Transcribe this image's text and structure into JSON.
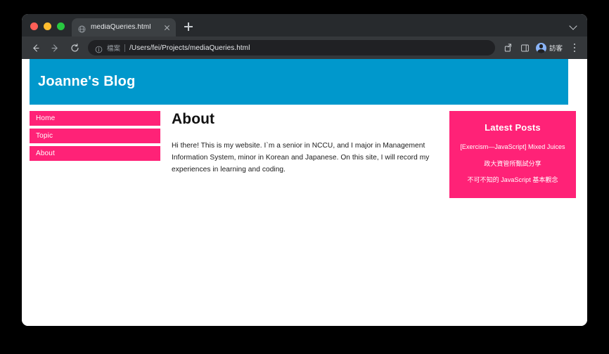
{
  "browser": {
    "traffic_lights": [
      "close",
      "minimize",
      "maximize"
    ],
    "tab": {
      "title": "mediaQueries.html",
      "favicon": "globe-icon",
      "close": "close-icon"
    },
    "new_tab_label": "+",
    "toolbar": {
      "back": "back-icon",
      "forward": "forward-icon",
      "reload": "reload-icon",
      "omnibox": {
        "info": "info-icon",
        "scheme_label": "檔案",
        "url": "/Users/fei/Projects/mediaQueries.html"
      },
      "share": "share-icon",
      "sidepanel": "side-panel-icon",
      "profile_label": "訪客",
      "menu": "kebab-menu-icon"
    }
  },
  "page": {
    "header": {
      "title": "Joanne's Blog",
      "background": "#0098cc"
    },
    "nav": {
      "items": [
        {
          "label": "Home"
        },
        {
          "label": "Topic"
        },
        {
          "label": "About"
        }
      ],
      "background": "#ff2277"
    },
    "main": {
      "heading": "About",
      "paragraph": "Hi there! This is my website. I`m a senior in NCCU, and I major in Management Information System, minor in Korean and Japanese. On this site, I will record my experiences in learning and coding."
    },
    "latest_posts": {
      "title": "Latest Posts",
      "background": "#ff2277",
      "items": [
        {
          "label": "[Exercism—JavaScript] Mixed Juices"
        },
        {
          "label": "政大資管所甄試分享"
        },
        {
          "label": "不可不知的 JavaScript 基本觀念"
        }
      ]
    }
  }
}
